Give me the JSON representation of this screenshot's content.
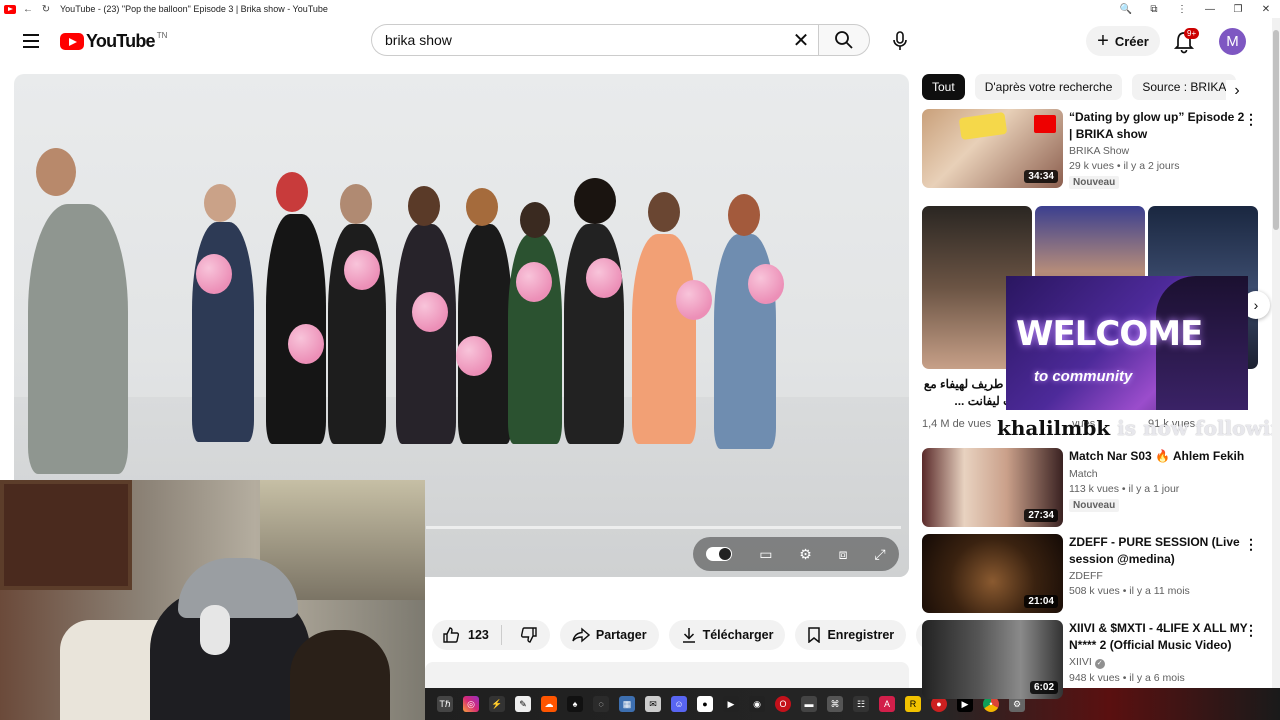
{
  "window": {
    "title": "YouTube - (23) \"Pop the balloon\" Episode 3 | Brika show - YouTube"
  },
  "masthead": {
    "logo_text": "YouTube",
    "country_code": "TN",
    "search_value": "brika show",
    "create_label": "Créer",
    "notifications_badge": "9+",
    "avatar_letter": "M"
  },
  "actions": {
    "likes": "123",
    "share": "Partager",
    "download": "Télécharger",
    "save": "Enregistrer"
  },
  "chips": [
    "Tout",
    "D'après votre recherche",
    "Source : BRIKA"
  ],
  "cards": [
    {
      "title": "“Dating by glow up” Episode 2 | BRIKA show",
      "channel": "BRIKA Show",
      "views": "29 k vues • il y a 2 jours",
      "badge": "Nouveau",
      "duration": "34:34"
    },
    {
      "title": "Match Nar S03 🔥 Ahlem Fekih",
      "channel": "Match",
      "views": "113 k vues • il y a 1 jour",
      "badge": "Nouveau",
      "duration": "27:34"
    },
    {
      "title": "ZDEFF - PURE SESSION (Live session @medina)",
      "channel": "ZDEFF",
      "views": "508 k vues • il y a 11 mois",
      "badge": "",
      "duration": "21:04"
    },
    {
      "title": "XIIVI & $MXTI - 4LIFE X ALL MY N**** 2 (Official Music Video)",
      "channel": "XIIVI",
      "views": "948 k vues • il y a 6 mois",
      "badge": "",
      "duration": "6:02"
    }
  ],
  "shorts": [
    {
      "title": "فيديو طريف لهيفاء مع سانت ليفانت ...",
      "views": "1,4 M de vues"
    },
    {
      "title": "",
      "views": "vues"
    },
    {
      "title": "",
      "views": "91 k vues"
    }
  ],
  "overlay": {
    "welcome": "WELCOME",
    "community": "to community",
    "follower": "khalilmbk",
    "follow_text": " is now following!"
  }
}
